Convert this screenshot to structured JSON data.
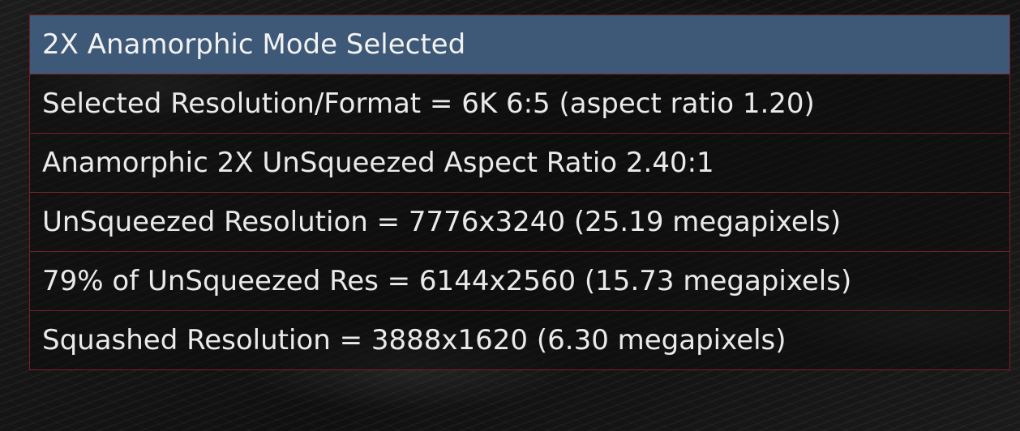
{
  "table": {
    "header": "2X Anamorphic Mode Selected",
    "rows": [
      "Selected Resolution/Format = 6K 6:5 (aspect ratio 1.20)",
      "Anamorphic 2X UnSqueezed Aspect Ratio 2.40:1",
      "UnSqueezed Resolution = 7776x3240 (25.19 megapixels)",
      "79% of UnSqueezed Res = 6144x2560 (15.73 megapixels)",
      "Squashed Resolution = 3888x1620 (6.30 megapixels)"
    ]
  },
  "colors": {
    "header_background": "#3e5878",
    "border": "#7a1f28",
    "text": "#eaeaea"
  }
}
